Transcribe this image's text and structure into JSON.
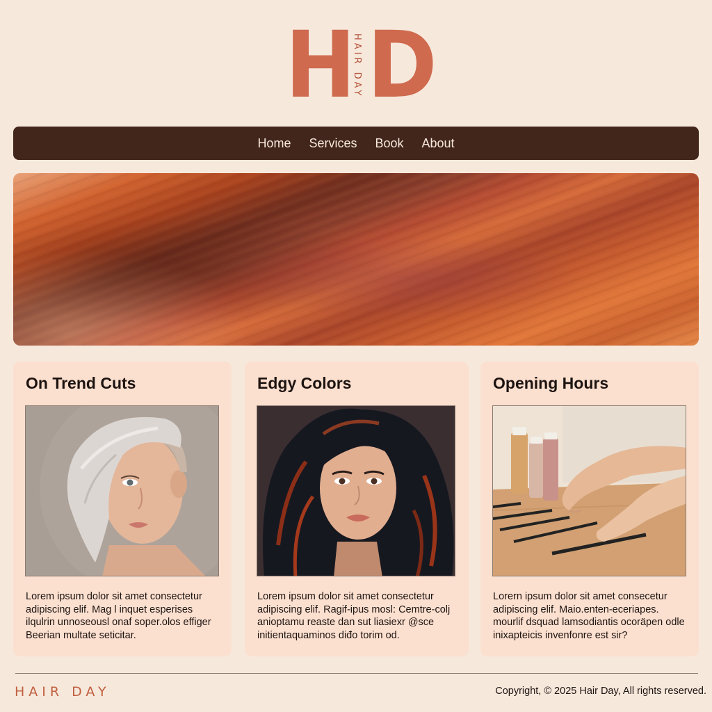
{
  "logo": {
    "left_letter": "H",
    "right_letter": "D",
    "vertical_text": "HAIR DAY",
    "color": "#cf6a4e"
  },
  "nav": {
    "items": [
      {
        "label": "Home"
      },
      {
        "label": "Services"
      },
      {
        "label": "Book"
      },
      {
        "label": "About"
      }
    ],
    "background": "#42261c"
  },
  "cards": [
    {
      "title": "On Trend Cuts",
      "image": "woman-platinum-undercut-bob",
      "text": "Lorem ipsum dolor sit amet consectetur adipiscing elif. Mag l inquet esperises ilqulrin unnoseousl onaf soper.olos effiger Beerian multate seticitar."
    },
    {
      "title": "Edgy Colors",
      "image": "woman-dark-wavy-hair-red-highlights",
      "text": "Lorem ipsum dolor sit amet consectetur adipiscing elif. Ragif-ipus mosl: Cemtre-colj anioptamu reaste dan sut liasiexr @sce initientaquaminos diđo torim od."
    },
    {
      "title": "Opening Hours",
      "image": "hands-arranging-hair-clips-on-table",
      "text": "Lorern ipsum dolor sit amet consecetur adipiscing elif. Maio.enten-eceriapes. mourlif dsquad lamsodiantis ocoräpen odle inixapteicis invenfonre est sir?"
    }
  ],
  "footer": {
    "brand": "HAIR DAY",
    "copyright": "Copyright, © 2025 Hair Day, All rights reserved."
  },
  "colors": {
    "page_bg": "#f7e8dc",
    "card_bg": "#fbdfcf",
    "accent": "#c0603f",
    "text": "#1d1411"
  }
}
